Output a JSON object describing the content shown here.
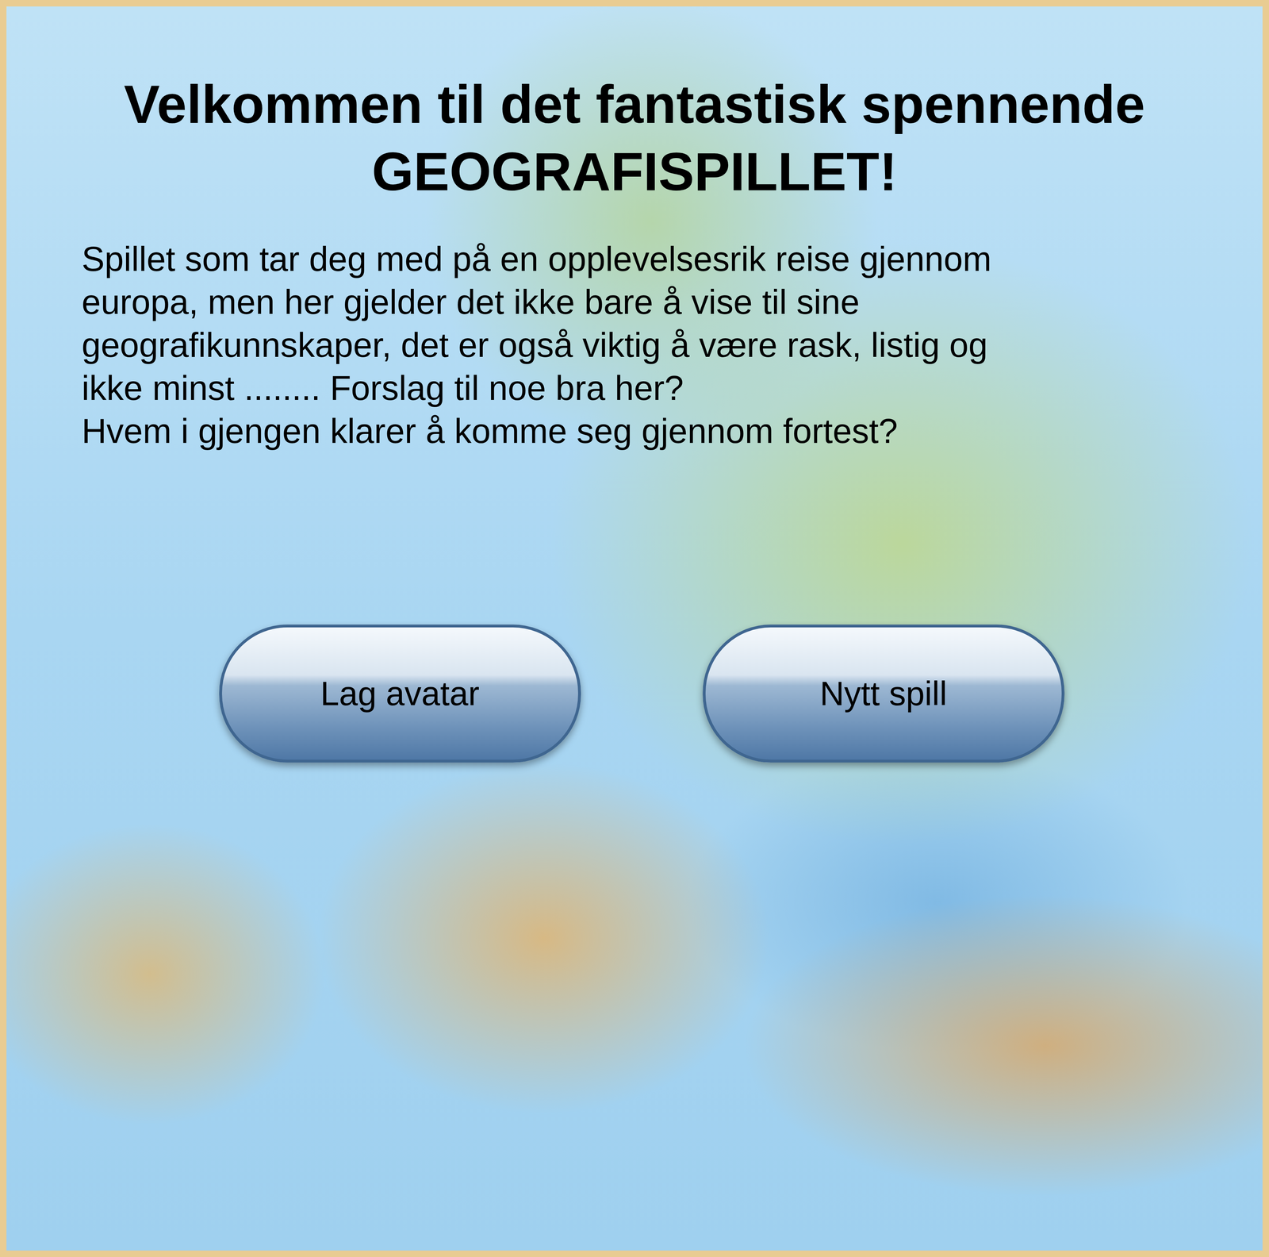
{
  "title": [
    "Velkommen til det fantastisk spennende",
    "GEOGRAFISPILLET!"
  ],
  "intro": [
    "Spillet som tar deg med på en opplevelsesrik reise gjennom",
    "europa, men her gjelder det ikke bare å vise til sine",
    "geografikunnskaper, det er også viktig å være rask, listig og",
    "ikke minst ........ Forslag til noe bra her?",
    "Hvem i gjengen klarer å komme seg gjennom fortest?"
  ],
  "buttons": [
    "Lag avatar",
    "Nytt spill"
  ]
}
